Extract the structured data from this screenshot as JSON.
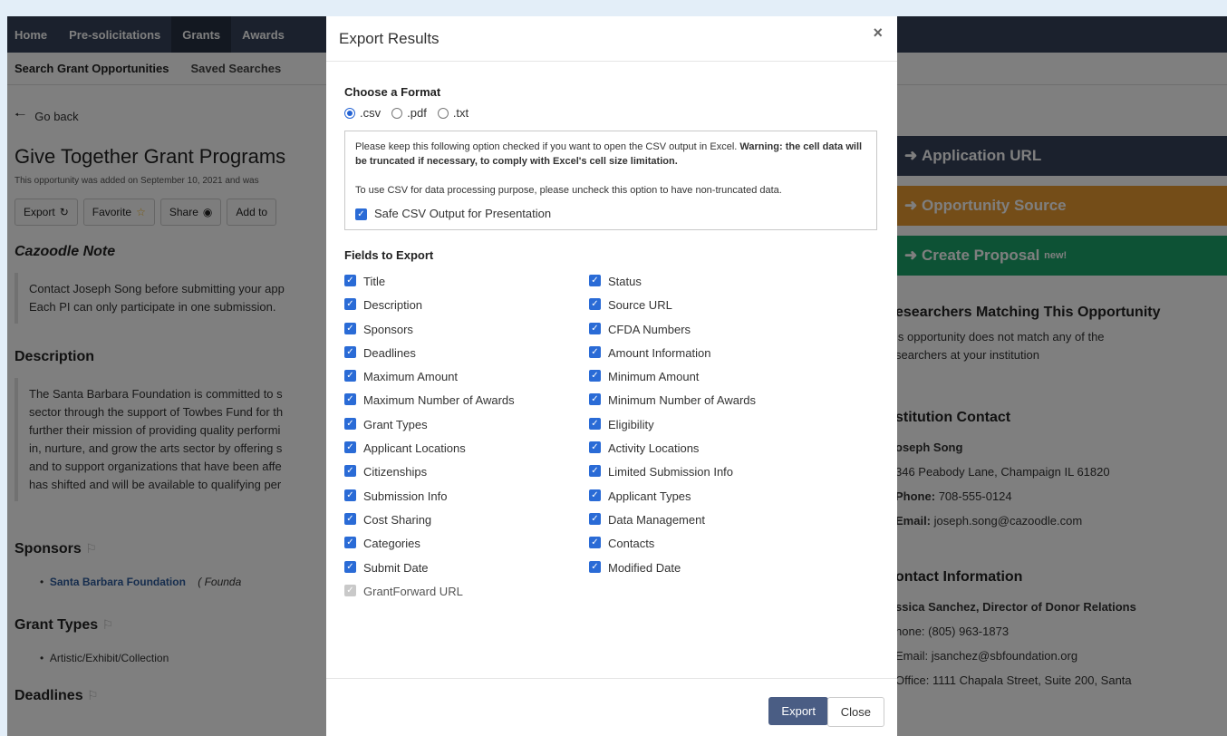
{
  "nav": {
    "items": [
      "Home",
      "Pre-solicitations",
      "Grants",
      "Awards"
    ],
    "active": "Grants"
  },
  "subnav": {
    "items": [
      "Search Grant Opportunities",
      "Saved Searches"
    ]
  },
  "page": {
    "go_back": "Go back",
    "title": "Give Together Grant Programs",
    "added": "This opportunity was added on September 10, 2021 and was",
    "buttons": {
      "export": "Export",
      "favorite": "Favorite",
      "share": "Share",
      "add_to": "Add to"
    },
    "note_heading": "Cazoodle Note",
    "note_lines": [
      "Contact Joseph Song before submitting your app",
      "Each PI can only participate in one submission."
    ],
    "description_heading": "Description",
    "description_lines": [
      "The Santa Barbara Foundation is committed to s",
      "sector through the support of Towbes Fund for th",
      "further their mission of providing quality performi",
      "in, nurture, and grow the arts sector by offering s",
      "and to support organizations that have been affe",
      "has shifted and will be available to qualifying per"
    ],
    "sponsors_heading": "Sponsors",
    "sponsor_name": "Santa Barbara Foundation",
    "sponsor_type": "( Founda",
    "grant_types_heading": "Grant Types",
    "grant_type": "Artistic/Exhibit/Collection",
    "deadlines_heading": "Deadlines"
  },
  "sidebar": {
    "application_url": "Application URL",
    "opportunity_source": "Opportunity Source",
    "create_proposal": "Create Proposal",
    "create_proposal_badge": "new!",
    "researchers_heading": "esearchers Matching This Opportunity",
    "researchers_text_1": "is opportunity does not match any of the",
    "researchers_text_2": "searchers at your institution",
    "institution_contact_heading": "stitution Contact",
    "contact_name": "oseph Song",
    "contact_address": "346 Peabody Lane, Champaign IL 61820",
    "contact_phone_label": "Phone:",
    "contact_phone": "708-555-0124",
    "contact_email_label": "Email:",
    "contact_email": "joseph.song@cazoodle.com",
    "contact_info_heading": "ontact Information",
    "donor_name": "ssica Sanchez, Director of Donor Relations",
    "donor_phone": "hone: (805) 963-1873",
    "donor_email": "Email: jsanchez@sbfoundation.org",
    "donor_office": "Office: 1111 Chapala Street, Suite 200, Santa"
  },
  "modal": {
    "title": "Export Results",
    "close_glyph": "×",
    "format_heading": "Choose a Format",
    "formats": [
      ".csv",
      ".pdf",
      ".txt"
    ],
    "selected_format": ".csv",
    "warning_text": "Please keep this following option checked if you want to open the CSV output in Excel.",
    "warning_bold": "Warning: the cell data will be truncated if necessary, to comply with Excel's cell size limitation.",
    "warning_text_2": "To use CSV for data processing purpose, please uncheck this option to have non-truncated data.",
    "safe_csv_label": "Safe CSV Output for Presentation",
    "fields_heading": "Fields to Export",
    "fields_left": [
      "Title",
      "Description",
      "Sponsors",
      "Deadlines",
      "Maximum Amount",
      "Maximum Number of Awards",
      "Grant Types",
      "Applicant Locations",
      "Citizenships",
      "Submission Info",
      "Cost Sharing",
      "Categories",
      "Submit Date"
    ],
    "fields_left_disabled": "GrantForward URL",
    "fields_right": [
      "Status",
      "Source URL",
      "CFDA Numbers",
      "Amount Information",
      "Minimum Amount",
      "Minimum Number of Awards",
      "Eligibility",
      "Activity Locations",
      "Limited Submission Info",
      "Applicant Types",
      "Data Management",
      "Contacts",
      "Modified Date"
    ],
    "export_button": "Export",
    "close_button": "Close"
  }
}
